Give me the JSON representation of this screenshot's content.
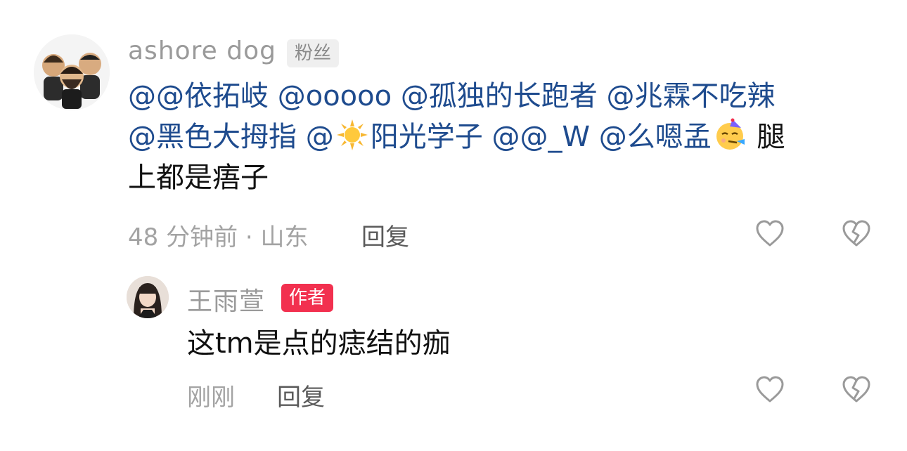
{
  "comments": [
    {
      "username": "ashore  dog",
      "badge": "粉丝",
      "body": {
        "line1": [
          "@@依拓岐",
          "@ooooo",
          "@孤独的长跑者",
          "@兆霖不吃辣"
        ],
        "line2_a": [
          "@黑色大拇指",
          "@"
        ],
        "line2_b": "阳光学子",
        "line2_c": [
          "@@_W",
          "@么嗯孟"
        ],
        "line2_tail": "腿",
        "line3": "上都是痦子"
      },
      "meta": "48 分钟前 · 山东",
      "reply": "回复",
      "icons": [
        "heart-icon",
        "broken-heart-icon"
      ]
    },
    {
      "username": "王雨萱",
      "badge": "作者",
      "body": "这tm是点的痣结的痂",
      "meta": "刚刚",
      "reply": "回复",
      "icons": [
        "heart-icon",
        "broken-heart-icon"
      ]
    }
  ],
  "colors": {
    "mention": "#1e4b8e",
    "author_badge": "#f2304f",
    "fan_badge_bg": "#efefef",
    "muted": "#9a9a9a"
  }
}
